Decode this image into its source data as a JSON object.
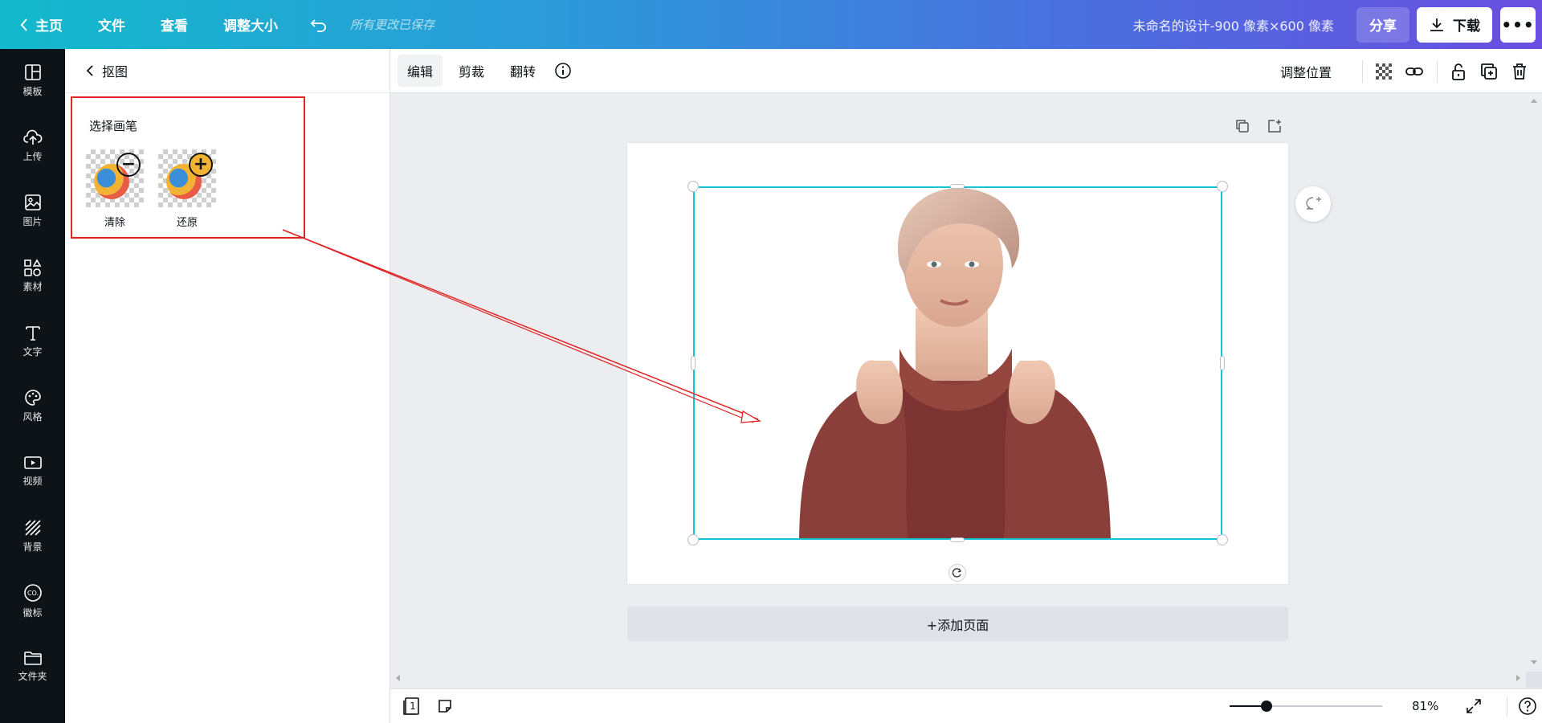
{
  "topbar": {
    "home": "主页",
    "menus": [
      "文件",
      "查看",
      "调整大小"
    ],
    "saved": "所有更改已保存",
    "design_title": "未命名的设计-900 像素×600 像素",
    "share": "分享",
    "download": "下载"
  },
  "rail": [
    {
      "label": "模板",
      "icon": "template-icon"
    },
    {
      "label": "上传",
      "icon": "upload-icon"
    },
    {
      "label": "图片",
      "icon": "image-icon"
    },
    {
      "label": "素材",
      "icon": "elements-icon"
    },
    {
      "label": "文字",
      "icon": "text-icon"
    },
    {
      "label": "风格",
      "icon": "palette-icon"
    },
    {
      "label": "视频",
      "icon": "video-icon"
    },
    {
      "label": "背景",
      "icon": "background-icon"
    },
    {
      "label": "徽标",
      "icon": "logo-icon"
    },
    {
      "label": "文件夹",
      "icon": "folder-icon"
    }
  ],
  "panel": {
    "title": "抠图",
    "section": "选择画笔",
    "brushes": [
      {
        "label": "清除",
        "symbol": "−"
      },
      {
        "label": "还原",
        "symbol": "+"
      }
    ]
  },
  "editor_toolbar": {
    "tabs": [
      "编辑",
      "剪裁",
      "翻转"
    ],
    "position": "调整位置"
  },
  "canvas": {
    "add_page": "+添加页面"
  },
  "bottom": {
    "page_number": "1",
    "zoom": "81%",
    "zoom_fraction": 0.24
  },
  "colors": {
    "selection": "#13c4d4",
    "annotation": "#e02424",
    "rail": "#0e1318"
  }
}
